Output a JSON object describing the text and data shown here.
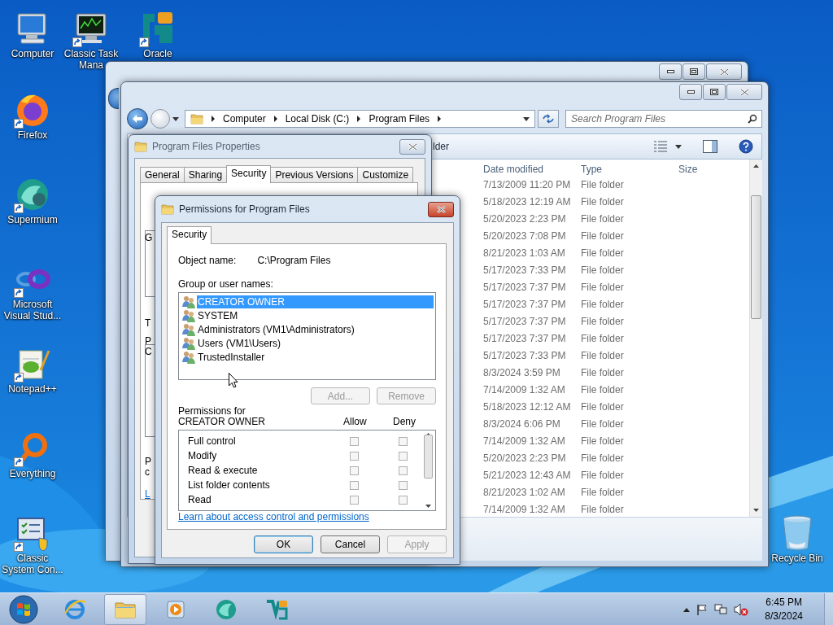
{
  "desktop_icons": [
    {
      "label": "Computer",
      "kind": "computer",
      "shortcut": false
    },
    {
      "label": "Classic Task Mana",
      "kind": "taskmgr",
      "shortcut": true
    },
    {
      "label": "Oracle",
      "kind": "oracle",
      "shortcut": true
    },
    {
      "label": "Firefox",
      "kind": "firefox",
      "shortcut": true
    },
    {
      "label": "Supermium",
      "kind": "supermium",
      "shortcut": true
    },
    {
      "label": "Microsoft Visual Stud...",
      "kind": "visualstudio",
      "shortcut": true
    },
    {
      "label": "Notepad++",
      "kind": "notepad",
      "shortcut": true
    },
    {
      "label": "Everything",
      "kind": "everything",
      "shortcut": true
    },
    {
      "label": "Classic System Con...",
      "kind": "controlpanel",
      "shortcut": true
    }
  ],
  "recycle_bin": {
    "label": "Recycle Bin"
  },
  "explorer": {
    "breadcrumb": [
      "Computer",
      "Local Disk (C:)",
      "Program Files"
    ],
    "search": {
      "placeholder": "Search Program Files"
    },
    "toolbar_fragment": "lder",
    "columns": [
      "Date modified",
      "Type",
      "Size"
    ],
    "rows": [
      {
        "date": "7/13/2009 11:20 PM",
        "type": "File folder"
      },
      {
        "date": "5/18/2023 12:19 AM",
        "type": "File folder"
      },
      {
        "date": "5/20/2023 2:23 PM",
        "type": "File folder"
      },
      {
        "date": "5/20/2023 7:08 PM",
        "type": "File folder"
      },
      {
        "date": "8/21/2023 1:03 AM",
        "type": "File folder"
      },
      {
        "date": "5/17/2023 7:33 PM",
        "type": "File folder"
      },
      {
        "date": "5/17/2023 7:37 PM",
        "type": "File folder"
      },
      {
        "date": "5/17/2023 7:37 PM",
        "type": "File folder"
      },
      {
        "date": "5/17/2023 7:37 PM",
        "type": "File folder"
      },
      {
        "date": "5/17/2023 7:37 PM",
        "type": "File folder"
      },
      {
        "date": "5/17/2023 7:33 PM",
        "type": "File folder"
      },
      {
        "date": "8/3/2024 3:59 PM",
        "type": "File folder"
      },
      {
        "date": "7/14/2009 1:32 AM",
        "type": "File folder"
      },
      {
        "date": "5/18/2023 12:12 AM",
        "type": "File folder"
      },
      {
        "date": "8/3/2024 6:06 PM",
        "type": "File folder"
      },
      {
        "date": "7/14/2009 1:32 AM",
        "type": "File folder"
      },
      {
        "date": "5/20/2023 2:23 PM",
        "type": "File folder"
      },
      {
        "date": "5/21/2023 12:43 AM",
        "type": "File folder"
      },
      {
        "date": "8/21/2023 1:02 AM",
        "type": "File folder"
      },
      {
        "date": "7/14/2009 1:32 AM",
        "type": "File folder"
      }
    ]
  },
  "properties": {
    "title": "Program Files Properties",
    "tabs": [
      {
        "label": "General",
        "selected": false
      },
      {
        "label": "Sharing",
        "selected": false
      },
      {
        "label": "Security",
        "selected": true
      },
      {
        "label": "Previous Versions",
        "selected": false
      },
      {
        "label": "Customize",
        "selected": false
      }
    ],
    "partial_labels": [
      "G",
      "T",
      "P",
      "C",
      "P",
      "c"
    ],
    "partial_link": "L"
  },
  "permissions": {
    "title": "Permissions for Program Files",
    "tabs": [
      {
        "label": "Security",
        "selected": true
      }
    ],
    "object_label": "Object name:",
    "object_value": "C:\\Program Files",
    "group_label": "Group or user names:",
    "principals": [
      {
        "name": "CREATOR OWNER",
        "selected": true
      },
      {
        "name": "SYSTEM",
        "selected": false
      },
      {
        "name": "Administrators (VM1\\Administrators)",
        "selected": false
      },
      {
        "name": "Users (VM1\\Users)",
        "selected": false
      },
      {
        "name": "TrustedInstaller",
        "selected": false
      }
    ],
    "principal_buttons": [
      {
        "label": "Add...",
        "disabled": true
      },
      {
        "label": "Remove",
        "disabled": true
      }
    ],
    "perm_label": "Permissions for CREATOR OWNER",
    "allow_header": "Allow",
    "deny_header": "Deny",
    "permissions": [
      {
        "name": "Full control",
        "allow": false,
        "deny": false
      },
      {
        "name": "Modify",
        "allow": false,
        "deny": false
      },
      {
        "name": "Read & execute",
        "allow": false,
        "deny": false
      },
      {
        "name": "List folder contents",
        "allow": false,
        "deny": false
      },
      {
        "name": "Read",
        "allow": false,
        "deny": false
      }
    ],
    "link": "Learn about access control and permissions",
    "buttons": [
      {
        "label": "OK",
        "default": true,
        "disabled": false
      },
      {
        "label": "Cancel",
        "default": false,
        "disabled": false
      },
      {
        "label": "Apply",
        "default": false,
        "disabled": true
      }
    ]
  },
  "taskbar": {
    "apps": [
      {
        "kind": "ie",
        "active": false
      },
      {
        "kind": "explorer",
        "active": true
      },
      {
        "kind": "media",
        "active": false
      },
      {
        "kind": "supermium",
        "active": false
      },
      {
        "kind": "vs",
        "active": false
      }
    ],
    "clock": {
      "time": "6:45 PM",
      "date": "8/3/2024"
    }
  }
}
